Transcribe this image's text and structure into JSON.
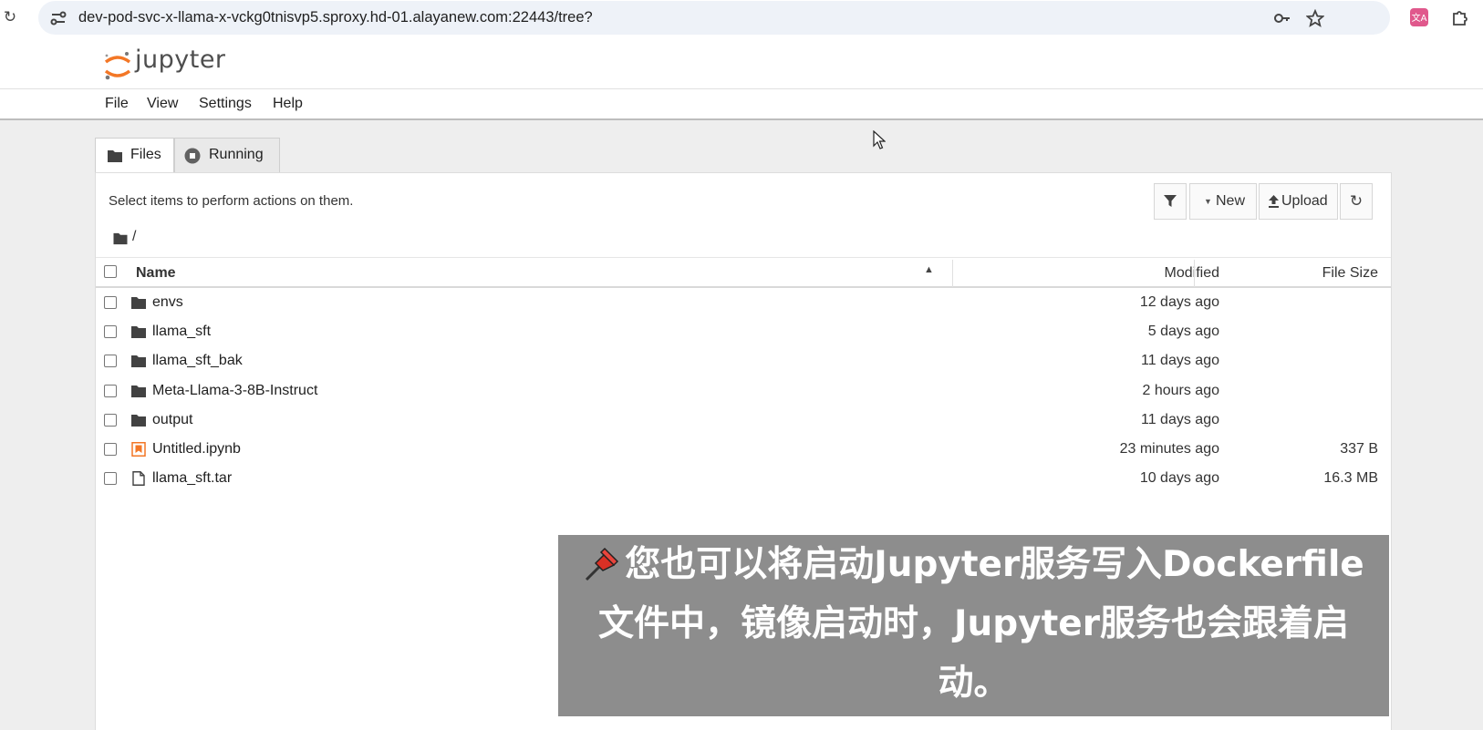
{
  "browser": {
    "url": "dev-pod-svc-x-llama-x-vckg0tnisvp5.sproxy.hd-01.alayanew.com:22443/tree?",
    "icons": [
      "reload-icon",
      "site-settings-icon",
      "key-icon",
      "star-icon",
      "translate-extension-icon",
      "extensions-icon"
    ]
  },
  "header": {
    "logo_text": "jupyter"
  },
  "menu": {
    "file": "File",
    "view": "View",
    "settings": "Settings",
    "help": "Help"
  },
  "tabs": {
    "files": "Files",
    "running": "Running"
  },
  "toolbar": {
    "hint": "Select items to perform actions on them.",
    "new_label": "New",
    "upload_label": "Upload"
  },
  "breadcrumb": {
    "path": "/"
  },
  "table": {
    "headers": {
      "name": "Name",
      "modified": "Modified",
      "size": "File Size"
    },
    "rows": [
      {
        "name": "envs",
        "type": "folder",
        "modified": "12 days ago",
        "size": ""
      },
      {
        "name": "llama_sft",
        "type": "folder",
        "modified": "5 days ago",
        "size": ""
      },
      {
        "name": "llama_sft_bak",
        "type": "folder",
        "modified": "11 days ago",
        "size": ""
      },
      {
        "name": "Meta-Llama-3-8B-Instruct",
        "type": "folder",
        "modified": "2 hours ago",
        "size": ""
      },
      {
        "name": "output",
        "type": "folder",
        "modified": "11 days ago",
        "size": ""
      },
      {
        "name": "Untitled.ipynb",
        "type": "notebook",
        "modified": "23 minutes ago",
        "size": "337 B"
      },
      {
        "name": "llama_sft.tar",
        "type": "file",
        "modified": "10 days ago",
        "size": "16.3 MB"
      }
    ]
  },
  "subtitle": {
    "text": "您也可以将启动Jupyter服务写入Dockerfile文件中，镜像启动时，Jupyter服务也会跟着启动。"
  },
  "colors": {
    "jupyter_orange": "#f37726",
    "subtitle_bg": "#8d8d8d",
    "pin_red": "#d93025"
  }
}
